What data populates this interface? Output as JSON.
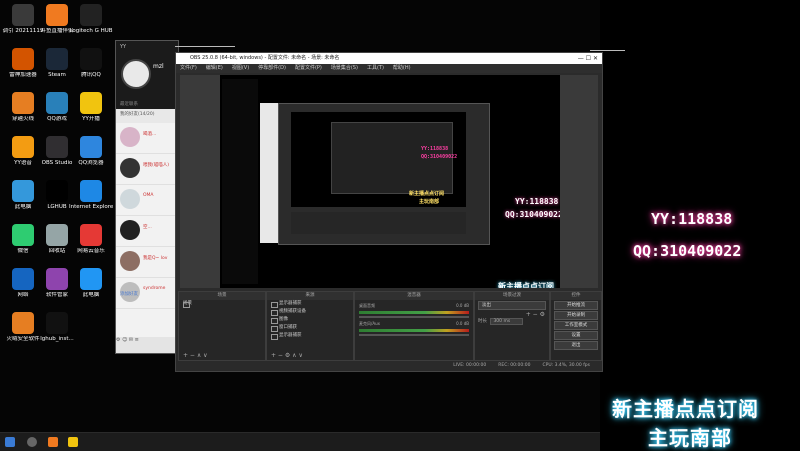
{
  "desktop_icons": [
    {
      "label": "调引\n20211119",
      "color": "#3a3a3a"
    },
    {
      "label": "斗鱼直播伴侣",
      "color": "#f07a20"
    },
    {
      "label": "Logitech G HUB",
      "color": "#222222"
    },
    {
      "label": "雷神加速器",
      "color": "#d35400"
    },
    {
      "label": "Steam",
      "color": "#1b2838"
    },
    {
      "label": "腾讯QQ",
      "color": "#111111"
    },
    {
      "label": "穿越火线",
      "color": "#e67e22"
    },
    {
      "label": "QQ游戏",
      "color": "#2980b9"
    },
    {
      "label": "YY开播",
      "color": "#f1c40f"
    },
    {
      "label": "YY语音",
      "color": "#f39c12"
    },
    {
      "label": "OBS Studio",
      "color": "#302e31"
    },
    {
      "label": "QQ浏览器",
      "color": "#2e86de"
    },
    {
      "label": "此电脑",
      "color": "#3498db"
    },
    {
      "label": "LGHUB",
      "color": "#000000"
    },
    {
      "label": "Internet Explorer",
      "color": "#1e88e5"
    },
    {
      "label": "微信",
      "color": "#2ecc71"
    },
    {
      "label": "回收站",
      "color": "#95a5a6"
    },
    {
      "label": "网易云音乐",
      "color": "#e53935"
    },
    {
      "label": "网络",
      "color": "#1565c0"
    },
    {
      "label": "软件管家",
      "color": "#8e44ad"
    },
    {
      "label": "此电脑",
      "color": "#2196f3"
    },
    {
      "label": "火绒安全软件",
      "color": "#e67e22"
    },
    {
      "label": "lghub_inst...",
      "color": "#111111"
    }
  ],
  "yy": {
    "title": "YY",
    "username": "mzl",
    "group_label": "我的好友(14/20)",
    "subtitle": "最近联系",
    "friends": [
      {
        "name": "喝酒...",
        "color": "#d8b4c8"
      },
      {
        "name": "喂我(喵喵人)",
        "color": "#333333"
      },
      {
        "name": "OMA",
        "color": "#cfd8dc"
      },
      {
        "name": "空...",
        "color": "#222222"
      },
      {
        "name": "我是Q~ lov",
        "color": "#8d6e63"
      },
      {
        "name": "syndrome",
        "color": "#bdbdbd"
      }
    ],
    "search": "添加好友",
    "bottom": "⚙  ☺  ✉  ≡"
  },
  "obs": {
    "title": "OBS 25.0.8 (64-bit, windows) - 配置文件: 未命名 - 场景: 未命名",
    "window_controls": "—  ☐  ✕",
    "menu": [
      "文件(F)",
      "编辑(E)",
      "视图(V)",
      "停靠部件(D)",
      "配置文件(P)",
      "场景集合(S)",
      "工具(T)",
      "帮助(H)"
    ],
    "scenes_header": "场景",
    "scenes": [
      "场景"
    ],
    "sources_header": "来源",
    "sources": [
      "显示器捕获",
      "视频捕获设备",
      "图像",
      "窗口捕获",
      "显示器捕获"
    ],
    "mixer_header": "混音器",
    "mixer": [
      {
        "name": "桌面音频",
        "db": "0.0 dB"
      },
      {
        "name": "麦克风/Aux",
        "db": "0.0 dB"
      }
    ],
    "transitions_header": "场景过渡",
    "transition": "淡出",
    "duration_label": "时长",
    "duration": "300 ms",
    "controls_header": "控件",
    "controls": [
      "开始推流",
      "开始录制",
      "工作室模式",
      "设置",
      "退出"
    ],
    "status": [
      "LIVE: 00:00:00",
      "REC: 00:00:00",
      "CPU: 3.4%, 30.00 fps"
    ]
  },
  "overlay": {
    "yy_id": "YY:118838",
    "qq_id": "QQ:310409022",
    "line1": "新主播点点订阅",
    "line2": "主玩南部"
  },
  "colors": {
    "neon_pink": "#ff3fa4",
    "neon_cyan": "#39d0ff",
    "neon_yellow": "#ffe066"
  }
}
